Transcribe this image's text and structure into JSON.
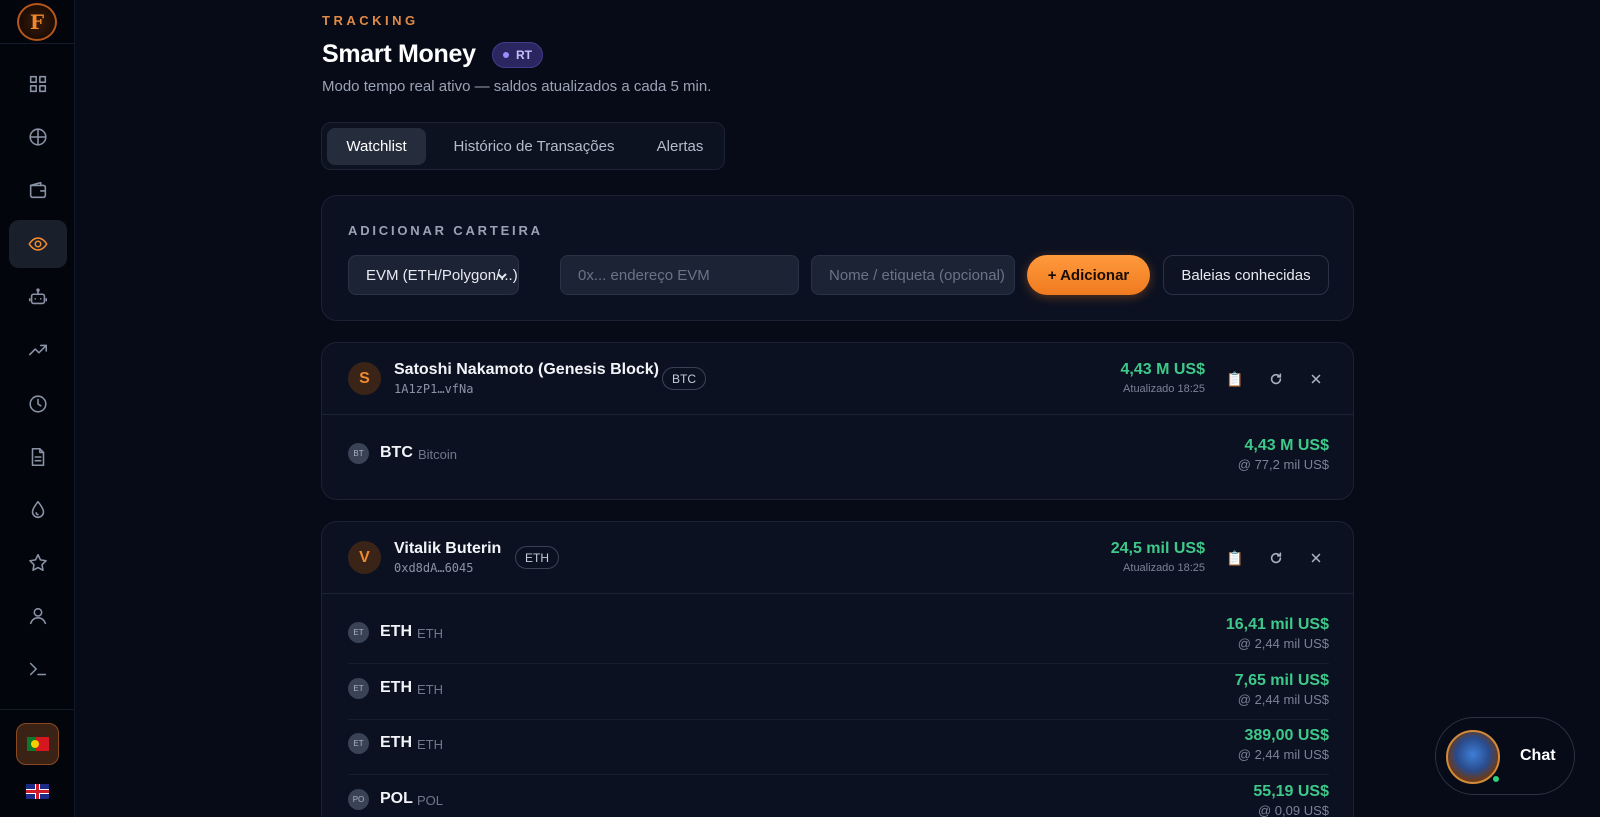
{
  "header": {
    "eyebrow": "TRACKING",
    "title": "Smart Money",
    "rt_badge": "RT",
    "subtitle": "Modo tempo real ativo — saldos atualizados a cada 5 min."
  },
  "tabs": [
    {
      "label": "Watchlist",
      "active": true
    },
    {
      "label": "Histórico de Transações",
      "active": false
    },
    {
      "label": "Alertas",
      "active": false
    }
  ],
  "add_wallet": {
    "section_label": "ADICIONAR CARTEIRA",
    "chain_select_value": "EVM (ETH/Polygon/...)",
    "address_placeholder": "0x... endereço EVM",
    "name_placeholder": "Nome / etiqueta (opcional)",
    "add_button": "+ Adicionar",
    "whales_button": "Baleias conhecidas"
  },
  "wallets": [
    {
      "initial": "S",
      "name": "Satoshi Nakamoto (Genesis Block)",
      "address": "1A1zP1…vfNa",
      "chain": "BTC",
      "total": "4,43 M US$",
      "updated": "Atualizado 18:25",
      "assets": [
        {
          "icon": "BT",
          "symbol": "BTC",
          "name": "Bitcoin",
          "value": "4,43 M US$",
          "price": "@ 77,2 mil US$"
        }
      ]
    },
    {
      "initial": "V",
      "name": "Vitalik Buterin",
      "address": "0xd8dA…6045",
      "chain": "ETH",
      "total": "24,5 mil US$",
      "updated": "Atualizado 18:25",
      "assets": [
        {
          "icon": "ET",
          "symbol": "ETH",
          "name": "ETH",
          "value": "16,41 mil US$",
          "price": "@ 2,44 mil US$"
        },
        {
          "icon": "ET",
          "symbol": "ETH",
          "name": "ETH",
          "value": "7,65 mil US$",
          "price": "@ 2,44 mil US$"
        },
        {
          "icon": "ET",
          "symbol": "ETH",
          "name": "ETH",
          "value": "389,00 US$",
          "price": "@ 2,44 mil US$"
        },
        {
          "icon": "PO",
          "symbol": "POL",
          "name": "POL",
          "value": "55,19 US$",
          "price": "@ 0,09 US$"
        }
      ]
    }
  ],
  "sidebar": {
    "logo": "F",
    "items": [
      "grid-icon",
      "globe-icon",
      "wallet-icon",
      "eye-icon",
      "robot-icon",
      "trending-icon",
      "clock-icon",
      "document-icon",
      "drop-icon",
      "star-icon",
      "user-icon",
      "terminal-icon"
    ],
    "active_item": "eye-icon",
    "languages": [
      "pt-flag-icon",
      "uk-flag-icon"
    ]
  },
  "chat": {
    "label": "Chat"
  },
  "colors": {
    "accent": "#f08a2e",
    "positive": "#3ec98a",
    "background": "#070b17"
  }
}
